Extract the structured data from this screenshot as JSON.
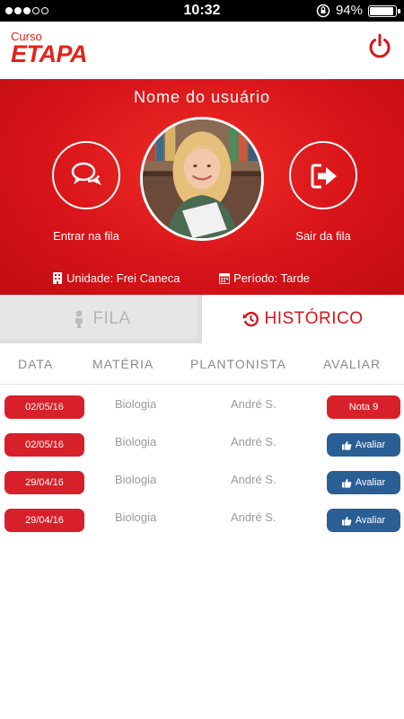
{
  "status_bar": {
    "time": "10:32",
    "battery": "94%",
    "battery_level": 0.94
  },
  "header": {
    "logo_small": "Curso",
    "logo_big": "ETAPA"
  },
  "hero": {
    "user_name": "Nome do usuário",
    "enter_label": "Entrar na fila",
    "exit_label": "Sair da fila",
    "unit": "Unidade: Frei Caneca",
    "period": "Período: Tarde"
  },
  "tabs": [
    {
      "label": "FILA",
      "active": false
    },
    {
      "label": "HISTÓRICO",
      "active": true
    }
  ],
  "table": {
    "headers": [
      "DATA",
      "MATÉRIA",
      "PLANTONISTA",
      "AVALIAR"
    ],
    "rows": [
      {
        "date": "02/05/16",
        "subject": "Biologia",
        "tutor": "André S.",
        "action": "Nota 9",
        "action_type": "grade"
      },
      {
        "date": "02/05/16",
        "subject": "Biologia",
        "tutor": "André S.",
        "action": "Avaliar",
        "action_type": "rate"
      },
      {
        "date": "29/04/16",
        "subject": "Biologia",
        "tutor": "André S.",
        "action": "Avaliar",
        "action_type": "rate"
      },
      {
        "date": "29/04/16",
        "subject": "Biologia",
        "tutor": "André S.",
        "action": "Avaliar",
        "action_type": "rate"
      }
    ]
  },
  "colors": {
    "primary": "#d8141a",
    "accent_blue": "#2a5f96",
    "muted_text": "#9a9a9a"
  }
}
